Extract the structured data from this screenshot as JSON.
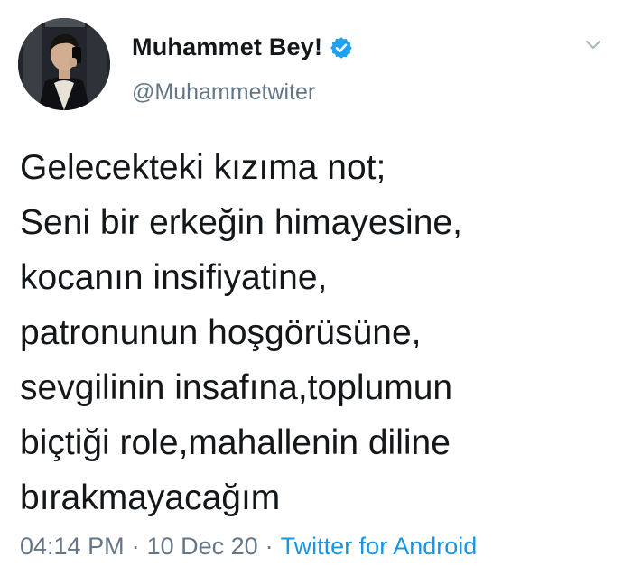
{
  "author": {
    "display_name": "Muhammet Bey!",
    "handle": "@Muhammetwiter",
    "verified": true
  },
  "tweet": {
    "lines": [
      "Gelecekteki kızıma not;",
      "Seni bir erkeğin himayesine,",
      "kocanın insifiyatine,",
      "patronunun hoşgörüsüne,",
      "sevgilinin insafına,toplumun",
      "biçtiği role,mahallenin diline",
      "bırakmayacağım"
    ]
  },
  "meta": {
    "time": "04:14 PM",
    "separator": "·",
    "date": "10 Dec 20",
    "source": "Twitter for Android"
  },
  "colors": {
    "text": "#14171a",
    "secondary": "#657786",
    "link": "#1b95e0",
    "verified": "#1da1f2"
  },
  "icons": {
    "verified": "verified-badge-icon",
    "menu": "chevron-down-icon"
  }
}
